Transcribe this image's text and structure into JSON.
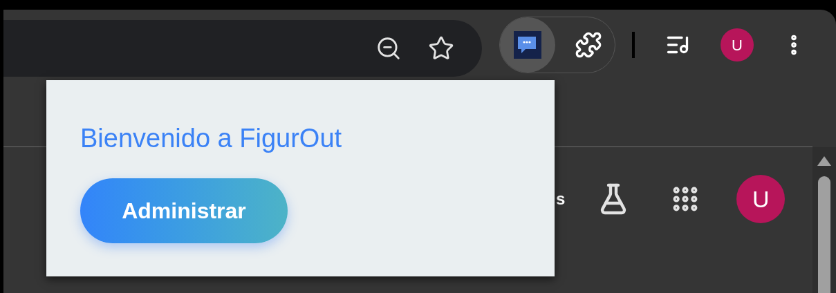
{
  "toolbar": {
    "extension_active": true,
    "profile_initial": "U"
  },
  "popup": {
    "title": "Bienvenido a FigurOut",
    "button": "Administrar"
  },
  "page": {
    "partial_label": "s",
    "profile_initial": "U"
  }
}
